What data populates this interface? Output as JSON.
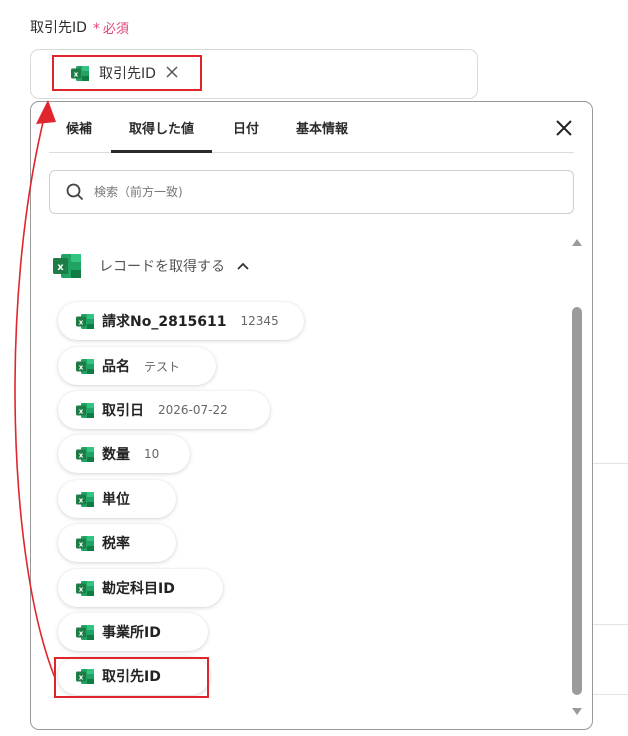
{
  "field": {
    "label": "取引先ID",
    "required_star": "*",
    "required_text": "必須",
    "selected_tag": "取引先ID"
  },
  "tabs": [
    {
      "label": "候補",
      "active": false
    },
    {
      "label": "取得した値",
      "active": true
    },
    {
      "label": "日付",
      "active": false
    },
    {
      "label": "基本情報",
      "active": false
    }
  ],
  "search": {
    "placeholder": "検索（前方一致)",
    "value": ""
  },
  "section": {
    "title": "レコードを取得する"
  },
  "items": [
    {
      "name": "請求No_2815611",
      "value": "12345"
    },
    {
      "name": "品名",
      "value": "テスト"
    },
    {
      "name": "取引日",
      "value": "2026-07-22"
    },
    {
      "name": "数量",
      "value": "10"
    },
    {
      "name": "単位",
      "value": ""
    },
    {
      "name": "税率",
      "value": ""
    },
    {
      "name": "勘定科目ID",
      "value": ""
    },
    {
      "name": "事業所ID",
      "value": ""
    },
    {
      "name": "取引先ID",
      "value": ""
    }
  ],
  "colors": {
    "excel_green": "#1e7d45",
    "highlight_red": "#e0262c",
    "required_pink": "#e0457b"
  },
  "icons": [
    "excel-icon",
    "close-icon",
    "search-icon",
    "chevron-up-icon",
    "scroll-up-icon",
    "scroll-down-icon"
  ]
}
